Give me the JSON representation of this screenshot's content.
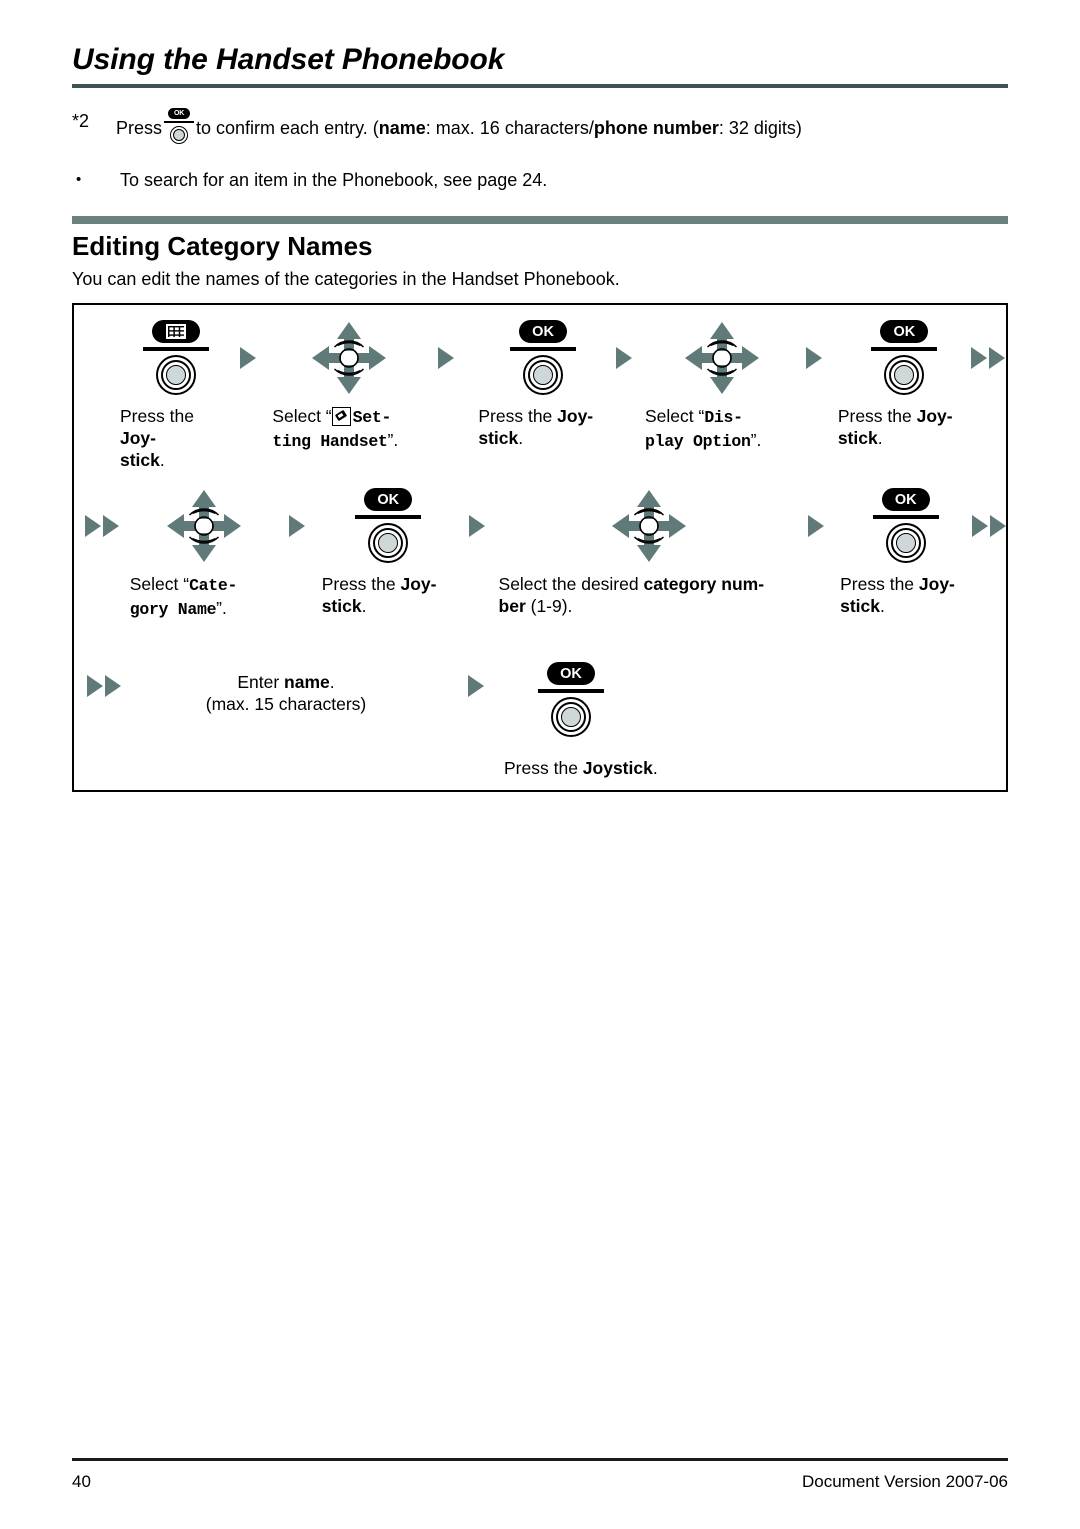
{
  "header": {
    "title": "Using the Handset Phonebook"
  },
  "notes": [
    {
      "marker": "*2",
      "text_before": "Press",
      "icon": "ok-joystick-icon",
      "text_after_1": "to confirm each entry. (",
      "bold_1": "name",
      "text_after_2": ": max. 16 characters/",
      "bold_2": "phone number",
      "text_after_3": ": 32 digits)"
    },
    {
      "marker": "•",
      "text": "To search for an item in the Phonebook, see page 24."
    }
  ],
  "section": {
    "title": "Editing Category Names",
    "description": "You can edit the names of the categories in the Handset Phonebook."
  },
  "procedure": {
    "rows": [
      {
        "row_id": "row-1",
        "steps": [
          {
            "icon": "menu-joystick-icon",
            "icon_label": "",
            "caption_parts": [
              {
                "t": "Press the ",
                "style": "plain"
              },
              {
                "t": "Joy-",
                "style": "bold"
              },
              {
                "t": "stick",
                "style": "bold"
              },
              {
                "t": ".",
                "style": "plain"
              }
            ],
            "caption_plain": "Press the Joy-stick."
          },
          {
            "icon": "four-way-navigator-icon",
            "caption_plain": "Select “⌲ Set-ting Handset”.",
            "select_prefix": "Select “",
            "select_mono_line1": "Set-",
            "select_mono_line2": "ting Handset",
            "select_suffix": "”."
          },
          {
            "icon": "ok-joystick-icon",
            "caption_plain": "Press the Joy-stick."
          },
          {
            "icon": "four-way-navigator-icon",
            "caption_plain": "Select “Dis-play Option”.",
            "select_prefix": "Select “",
            "select_mono_line1": "Dis-",
            "select_mono_line2": "play Option",
            "select_suffix": "”."
          },
          {
            "icon": "ok-joystick-icon",
            "caption_plain": "Press the Joy-stick."
          }
        ]
      },
      {
        "row_id": "row-2",
        "steps": [
          {
            "icon": "four-way-navigator-icon",
            "caption_plain": "Select “Cate-gory Name”.",
            "select_prefix": "Select “",
            "select_mono_line1": "Cate-",
            "select_mono_line2": "gory Name",
            "select_suffix": "”."
          },
          {
            "icon": "ok-joystick-icon",
            "caption_plain": "Press the Joy-stick."
          },
          {
            "icon": "four-way-navigator-icon",
            "caption_plain": "Select the desired category num-ber (1-9)."
          },
          {
            "icon": "ok-joystick-icon",
            "caption_plain": "Press the Joy-stick."
          }
        ]
      },
      {
        "row_id": "row-3",
        "steps": [
          {
            "icon": "none",
            "caption_line1_a": "Enter ",
            "caption_line1_b": "name",
            "caption_line1_c": ".",
            "caption_line2": "(max. 15 characters)"
          },
          {
            "icon": "ok-joystick-icon",
            "caption_a": "Press the ",
            "caption_b": "Joystick",
            "caption_c": "."
          }
        ]
      }
    ],
    "labels": {
      "press_the": "Press the ",
      "joy_hyphen": "Joy-",
      "stick": "stick",
      "period": ".",
      "joystick": "Joystick",
      "ok": "OK",
      "select_open_quote": "Select “",
      "close_quote_period": "”.",
      "set_line1": "Set-",
      "set_line2": "ting Handset",
      "dis_line1": "Dis-",
      "dis_line2": "play Option",
      "cate_line1": "Cate-",
      "cate_line2": "gory Name",
      "desired_a": "Select the desired ",
      "desired_b": "category num-",
      "desired_c": "ber",
      "desired_d": " (1-9).",
      "enter_a": "Enter ",
      "enter_b": "name",
      "enter_c": ".",
      "enter_line2": "(max. 15 characters)"
    }
  },
  "footer": {
    "page_number": "40",
    "document_version": "Document Version 2007-06"
  },
  "colors": {
    "arrow": "#5f7a78",
    "header_rule": "#3f5356",
    "section_bar": "#6a8180",
    "joystick_center": "#cfd8d8"
  }
}
